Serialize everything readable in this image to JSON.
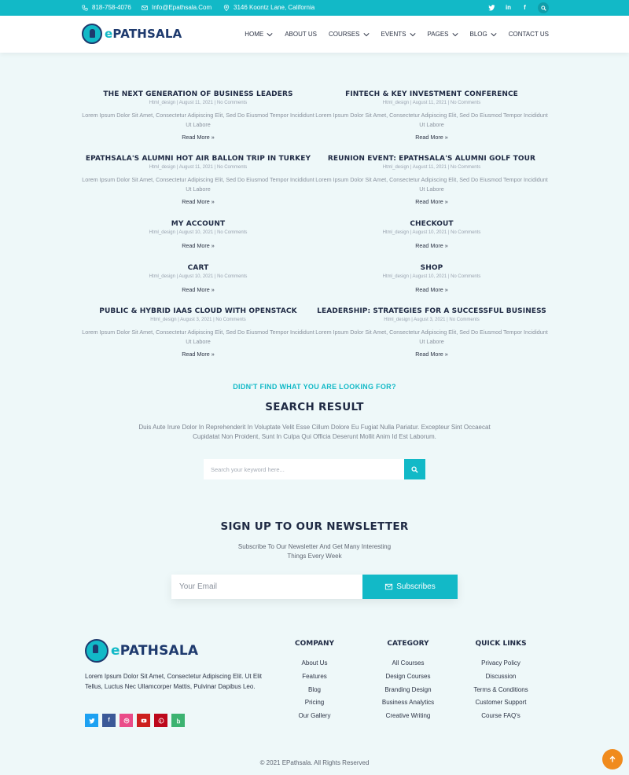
{
  "topbar": {
    "phone": "818-758-4076",
    "email": "Info@Epathsala.Com",
    "address": "3146 Koontz Lane, California",
    "social_icons": [
      "twitter-icon",
      "linkedin-icon",
      "facebook-icon"
    ],
    "bg_color": "#12b9c7"
  },
  "header": {
    "logo_prefix": "e",
    "logo_main": "PATHSALA",
    "nav": [
      {
        "label": "HOME",
        "dropdown": true
      },
      {
        "label": "ABOUT US",
        "dropdown": false
      },
      {
        "label": "COURSES",
        "dropdown": true
      },
      {
        "label": "EVENTS",
        "dropdown": true
      },
      {
        "label": "PAGES",
        "dropdown": true
      },
      {
        "label": "BLOG",
        "dropdown": true
      },
      {
        "label": "CONTACT US",
        "dropdown": false
      }
    ]
  },
  "posts": [
    {
      "title": "THE NEXT GENERATION OF BUSINESS LEADERS",
      "meta": "Html_design | August 11, 2021 | No Comments",
      "excerpt": "Lorem Ipsum Dolor Sit Amet, Consectetur Adipiscing Elit, Sed Do Eiusmod Tempor Incididunt Ut Labore",
      "more": "Read More »"
    },
    {
      "title": "FINTECH & KEY INVESTMENT CONFERENCE",
      "meta": "Html_design | August 11, 2021 | No Comments",
      "excerpt": "Lorem Ipsum Dolor Sit Amet, Consectetur Adipiscing Elit, Sed Do Eiusmod Tempor Incididunt Ut Labore",
      "more": "Read More »"
    },
    {
      "title": "EPATHSALA'S ALUMNI HOT AIR BALLON TRIP IN TURKEY",
      "meta": "Html_design | August 11, 2021 | No Comments",
      "excerpt": "Lorem Ipsum Dolor Sit Amet, Consectetur Adipiscing Elit, Sed Do Eiusmod Tempor Incididunt Ut Labore",
      "more": "Read More »"
    },
    {
      "title": "REUNION EVENT: EPATHSALA'S ALUMNI GOLF TOUR",
      "meta": "Html_design | August 11, 2021 | No Comments",
      "excerpt": "Lorem Ipsum Dolor Sit Amet, Consectetur Adipiscing Elit, Sed Do Eiusmod Tempor Incididunt Ut Labore",
      "more": "Read More »"
    },
    {
      "title": "MY ACCOUNT",
      "meta": "Html_design | August 10, 2021 | No Comments",
      "excerpt": "",
      "more": "Read More »"
    },
    {
      "title": "CHECKOUT",
      "meta": "Html_design | August 10, 2021 | No Comments",
      "excerpt": "",
      "more": "Read More »"
    },
    {
      "title": "CART",
      "meta": "Html_design | August 10, 2021 | No Comments",
      "excerpt": "",
      "more": "Read More »"
    },
    {
      "title": "SHOP",
      "meta": "Html_design | August 10, 2021 | No Comments",
      "excerpt": "",
      "more": "Read More »"
    },
    {
      "title": "PUBLIC & HYBRID IAAS CLOUD WITH OPENSTACK",
      "meta": "Html_design | August 3, 2021 | No Comments",
      "excerpt": "Lorem Ipsum Dolor Sit Amet, Consectetur Adipiscing Elit, Sed Do Eiusmod Tempor Incididunt Ut Labore",
      "more": "Read More »"
    },
    {
      "title": "LEADERSHIP: STRATEGIES FOR A SUCCESSFUL BUSINESS",
      "meta": "Html_design | August 3, 2021 | No Comments",
      "excerpt": "Lorem Ipsum Dolor Sit Amet, Consectetur Adipiscing Elit, Sed Do Eiusmod Tempor Incididunt Ut Labore",
      "more": "Read More »"
    }
  ],
  "search": {
    "kicker": "DIDN'T FIND WHAT YOU ARE LOOKING FOR?",
    "title": "SEARCH RESULT",
    "description": "Duis Aute Irure Dolor In Reprehenderit In Voluptate Velit Esse Cillum Dolore Eu Fugiat Nulla Pariatur. Excepteur Sint Occaecat Cupidatat Non Proident, Sunt In Culpa Qui Officia Deserunt Mollit Anim Id Est Laborum.",
    "placeholder": "Search your keyword here..."
  },
  "newsletter": {
    "title": "SIGN UP TO OUR NEWSLETTER",
    "description": "Subscribe To Our Newsletter And Get Many Interesting Things Every Week",
    "placeholder": "Your Email",
    "button": "Subscribes"
  },
  "footer": {
    "about": "Lorem Ipsum Dolor Sit Amet, Consectetur Adipiscing Elit. Ut Elit Tellus, Luctus Nec Ullamcorper Mattis, Pulvinar Dapibus Leo.",
    "social": [
      {
        "icon": "twitter-icon",
        "color": "#1da1f2"
      },
      {
        "icon": "facebook-icon",
        "color": "#3b5998"
      },
      {
        "icon": "dribbble-icon",
        "color": "#ea4c89"
      },
      {
        "icon": "youtube-icon",
        "color": "#cd201f"
      },
      {
        "icon": "pinterest-icon",
        "color": "#bd081c"
      },
      {
        "icon": "houzz-icon",
        "color": "#3cb371"
      }
    ],
    "columns": [
      {
        "heading": "COMPANY",
        "links": [
          "About Us",
          "Features",
          "Blog",
          "Pricing",
          "Our Gallery"
        ]
      },
      {
        "heading": "CATEGORY",
        "links": [
          "All Courses",
          "Design Courses",
          "Branding Design",
          "Business Analytics",
          "Creative Writing"
        ]
      },
      {
        "heading": "QUICK LINKS",
        "links": [
          "Privacy Policy",
          "Discussion",
          "Terms & Conditions",
          "Customer Support",
          "Course FAQ's"
        ]
      }
    ],
    "copyright": "© 2021 EPathsala. All Rights Reserved"
  },
  "colors": {
    "accent": "#12b9c7",
    "dark": "#1f2a44",
    "scroll_top": "#f08b1d"
  }
}
